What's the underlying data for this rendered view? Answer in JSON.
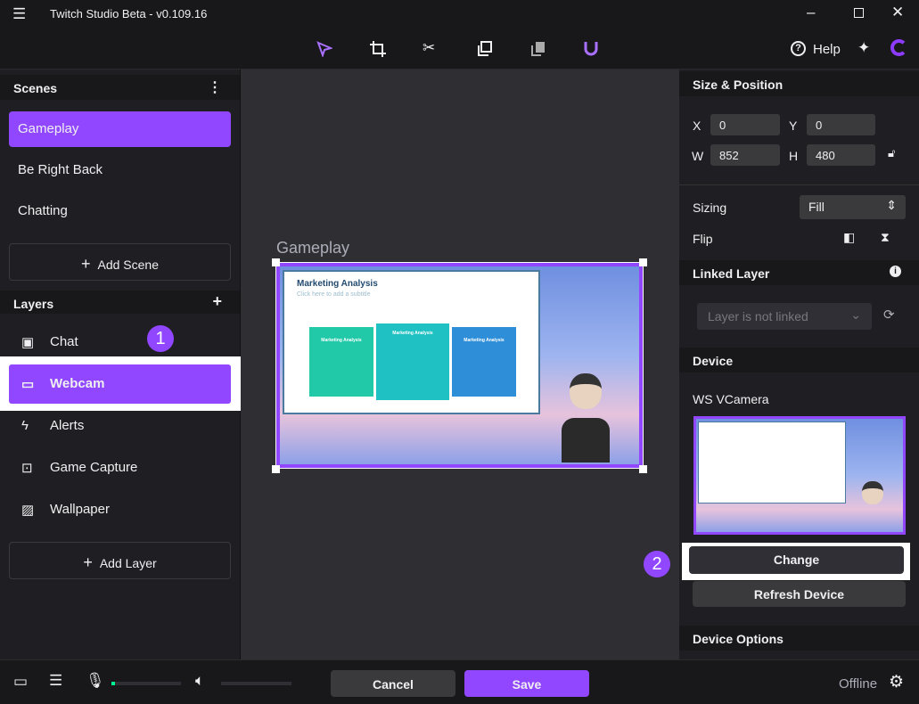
{
  "window": {
    "title": "Twitch Studio Beta - v0.109.16",
    "menu_icon": "hamburger-icon",
    "controls": [
      "minimize-icon",
      "maximize-icon",
      "close-icon"
    ]
  },
  "toolbar": {
    "tools": [
      "select-arrow-icon",
      "crop-icon",
      "scissors-icon",
      "duplicate-icon",
      "layers-stack-icon",
      "magnet-icon"
    ],
    "help_label": "Help",
    "accent": "#9147ff"
  },
  "scenes": {
    "title": "Scenes",
    "items": [
      {
        "label": "Gameplay",
        "selected": true
      },
      {
        "label": "Be Right Back"
      },
      {
        "label": "Chatting"
      }
    ],
    "add_label": "Add Scene"
  },
  "layers": {
    "title": "Layers",
    "items": [
      {
        "label": "Chat",
        "icon": "chat-icon"
      },
      {
        "label": "Webcam",
        "icon": "camera-icon",
        "selected": true
      },
      {
        "label": "Alerts",
        "icon": "alert-icon"
      },
      {
        "label": "Game Capture",
        "icon": "gamepad-icon"
      },
      {
        "label": "Wallpaper",
        "icon": "image-icon"
      }
    ],
    "add_label": "Add Layer"
  },
  "annotations": {
    "one": "1",
    "two": "2"
  },
  "canvas": {
    "scene_label": "Gameplay",
    "slide": {
      "title": "Marketing Analysis",
      "subtitle": "Click here to add a subtitle",
      "cards": [
        "Marketing Analysis",
        "Marketing Analysis",
        "Marketing Analysis"
      ]
    }
  },
  "size_position": {
    "title": "Size & Position",
    "x_label": "X",
    "x": "0",
    "y_label": "Y",
    "y": "0",
    "w_label": "W",
    "w": "852",
    "h_label": "H",
    "h": "480"
  },
  "sizing": {
    "label": "Sizing",
    "value": "Fill",
    "flip_label": "Flip"
  },
  "linked_layer": {
    "title": "Linked Layer",
    "placeholder": "Layer is not linked"
  },
  "device": {
    "title": "Device",
    "name": "WS VCamera",
    "change_label": "Change",
    "refresh_label": "Refresh Device"
  },
  "device_options": {
    "title": "Device Options"
  },
  "bottom": {
    "cancel_label": "Cancel",
    "save_label": "Save",
    "status": "Offline",
    "mic_level": 0.05
  }
}
